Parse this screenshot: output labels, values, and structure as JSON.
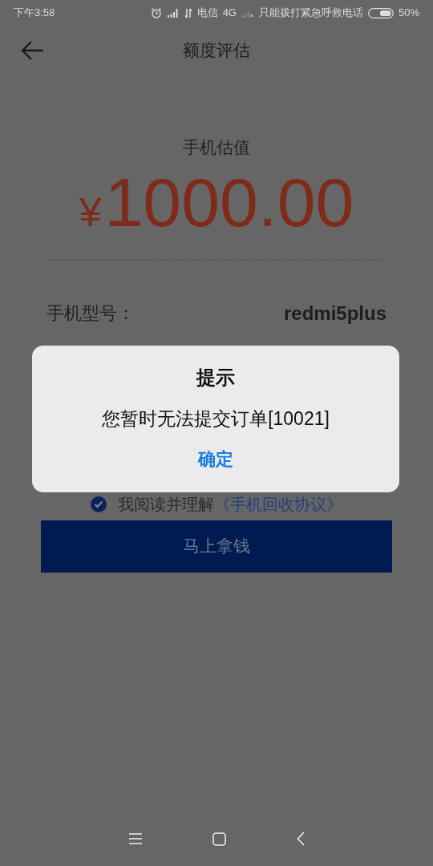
{
  "status_bar": {
    "time": "下午3:58",
    "carrier": "电信",
    "network": "4G",
    "notice": "只能拨打紧急呼救电话",
    "battery": "50%"
  },
  "header": {
    "title": "额度评估"
  },
  "valuation": {
    "label": "手机估值",
    "currency": "¥",
    "amount": "1000.00"
  },
  "info_rows": [
    {
      "label": "手机型号：",
      "value": "redmi5plus"
    }
  ],
  "agreement": {
    "checked": true,
    "text": "我阅读并理解",
    "link": "《手机回收协议》"
  },
  "submit_button": {
    "label": "马上拿钱"
  },
  "dialog": {
    "title": "提示",
    "message": "您暂时无法提交订单[10021]",
    "button": "确定"
  }
}
